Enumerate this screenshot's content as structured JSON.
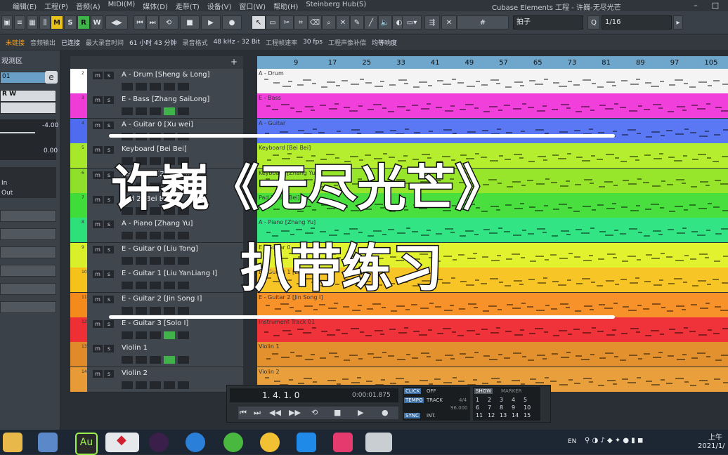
{
  "menubar": {
    "items": [
      "编辑(E)",
      "工程(P)",
      "音频(A)",
      "MIDI(M)",
      "媒体(D)",
      "走带(T)",
      "设备(V)",
      "窗口(W)",
      "帮助(H)",
      "Steinberg Hub(S)"
    ],
    "window_title": "Cubase Elements 工程 - 许巍-无尽光芒"
  },
  "toolbar": {
    "modes": [
      "M",
      "S",
      "R",
      "W"
    ],
    "snap_type": "拍子",
    "quantize": "1/16"
  },
  "infoline": {
    "fields": [
      "未链接",
      "音频输出",
      "已连接",
      "最大录音时间",
      "61 小时 43 分钟",
      "录音格式",
      "48 kHz - 32 Bit",
      "工程帧速率",
      "30 fps",
      "工程声像补偿",
      "均等响度"
    ]
  },
  "inspector": {
    "title": "观测区",
    "track_num": "01",
    "rw": "R  W",
    "vol1": "-4.00",
    "vol2": "0.00",
    "in_label": "In",
    "out_label": "Out"
  },
  "tracks": [
    {
      "num": "2",
      "name": "A - Drum [Sheng & Long]",
      "color": "#ffffff",
      "rec": false
    },
    {
      "num": "3",
      "name": "E - Bass [Zhang SaiLong]",
      "color": "#f03cd6",
      "rec": true
    },
    {
      "num": "4",
      "name": "A - Guitar 0 [Xu wei]",
      "color": "#4f6bf0",
      "rec": false
    },
    {
      "num": "5",
      "name": "Keyboard [Bei Bei]",
      "color": "#a8e82a",
      "rec": false
    },
    {
      "num": "6",
      "name": "Keyboard [Zhang Yu]",
      "color": "#8ee02a",
      "rec": false
    },
    {
      "num": "7",
      "name": "Pad 2 [Bei Bei]",
      "color": "#3fdc3a",
      "rec": false
    },
    {
      "num": "8",
      "name": "A - Piano [Zhang Yu]",
      "color": "#2ee07a",
      "rec": false
    },
    {
      "num": "9",
      "name": "E - Guitar 0 [Liu Tong]",
      "color": "#d9ef2a",
      "rec": false
    },
    {
      "num": "10",
      "name": "E - Guitar 1 [Liu YanLiang I]",
      "color": "#f5c21c",
      "rec": false
    },
    {
      "num": "11",
      "name": "E - Guitar 2 [Jin Song I]",
      "color": "#f58a1c",
      "rec": false
    },
    {
      "num": "12",
      "name": "E - Guitar 3 [Solo I]",
      "color": "#ee2f36",
      "rec": true
    },
    {
      "num": "13",
      "name": "Violin 1",
      "color": "#e08a2a",
      "rec": true
    },
    {
      "num": "14",
      "name": "Violin 2",
      "color": "#e79a35",
      "rec": false
    }
  ],
  "lanes": [
    {
      "label": "A - Drum",
      "color": "#f4f4f4"
    },
    {
      "label": "E - Bass",
      "color": "#f13fdb"
    },
    {
      "label": "A - Guitar",
      "color": "#5a78f4"
    },
    {
      "label": "Keyboard [Bei Bei]",
      "color": "#b5ee2e"
    },
    {
      "label": "Keyboard [Zhang Yu]",
      "color": "#98e62c"
    },
    {
      "label": "Pad 2 [Bei Bei]",
      "color": "#48df3f"
    },
    {
      "label": "A - Piano [Zhang Yu]",
      "color": "#33e484"
    },
    {
      "label": "E - Guitar 0",
      "color": "#e2f22f"
    },
    {
      "label": "E - Guitar 1 [Liu YanLiang I]",
      "color": "#f7c626"
    },
    {
      "label": "E - Guitar 2 [Jin Song I]",
      "color": "#f7922a"
    },
    {
      "label": "Instrument Track 01",
      "color": "#f0333a"
    },
    {
      "label": "Violin 1",
      "color": "#e3902e"
    },
    {
      "label": "Violin 2",
      "color": "#e9a03c"
    }
  ],
  "ruler": {
    "ticks": [
      "9",
      "17",
      "25",
      "33",
      "41",
      "49",
      "57",
      "65",
      "73",
      "81",
      "89",
      "97",
      "105"
    ]
  },
  "overlay": {
    "title": "许巍《无尽光芒》",
    "subtitle": "扒带练习"
  },
  "transport": {
    "position": "1. 4. 1.   0",
    "time": "0:00:01.875",
    "click": "CLICK",
    "click_state": "OFF",
    "tempo": "TEMPO",
    "tempo_state": "TRACK",
    "signature": "4/4",
    "bpm": "96.000",
    "sync": "SYNC",
    "sync_state": "INT.",
    "show": "SHOW",
    "marker": "MARKER",
    "markers": [
      "1",
      "2",
      "3",
      "4",
      "5",
      "6",
      "7",
      "8",
      "9",
      "10",
      "11",
      "12",
      "13",
      "14",
      "15"
    ]
  },
  "taskbar": {
    "ime": "EN",
    "time": "上午",
    "date": "2021/1/"
  }
}
